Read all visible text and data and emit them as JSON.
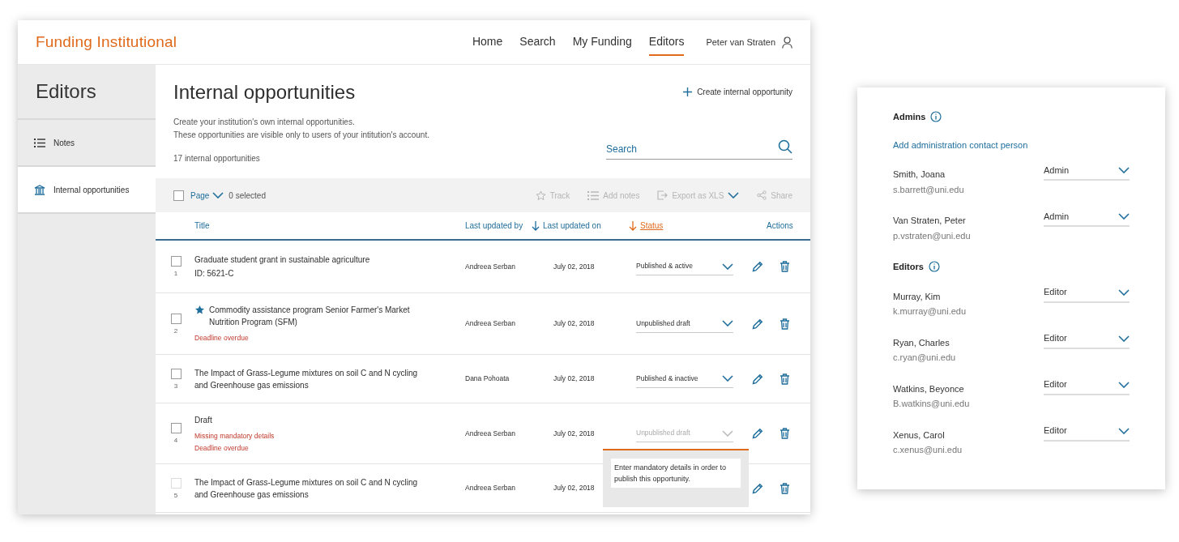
{
  "header": {
    "logo": "Funding Institutional",
    "nav": [
      {
        "label": "Home",
        "selected": false
      },
      {
        "label": "Search",
        "selected": false
      },
      {
        "label": "My Funding",
        "selected": false
      },
      {
        "label": "Editors",
        "selected": true
      }
    ],
    "user": "Peter van Straten"
  },
  "sidebar": {
    "title": "Editors",
    "items": [
      {
        "label": "Notes",
        "kind": "list",
        "selected": false
      },
      {
        "label": "Internal opportunities",
        "kind": "institution",
        "selected": true
      }
    ]
  },
  "main": {
    "title": "Internal opportunities",
    "create_button": "Create internal opportunity",
    "description": [
      "Create your institution's own internal opportunities.",
      "These opportunities are visible only to users of your intitution's account."
    ],
    "count": "17 internal opportunities",
    "search": {
      "placeholder": "Search"
    },
    "toolbar": {
      "select_all_checked": false,
      "page_label": "Page",
      "selected_count": "0 selected",
      "actions": [
        {
          "label": "Track",
          "kind": "star",
          "disabled": true
        },
        {
          "label": "Add notes",
          "kind": "list",
          "disabled": true
        },
        {
          "label": "Export as XLS",
          "kind": "export",
          "disabled": true
        },
        {
          "label": "Share",
          "kind": "share",
          "disabled": true
        }
      ]
    },
    "table": {
      "columns": [
        {
          "label": "Title",
          "sorted": false,
          "active": false
        },
        {
          "label": "Last updated by",
          "sorted": false,
          "active": false
        },
        {
          "label": "Last updated on",
          "sorted": true,
          "active": false
        },
        {
          "label": "Status",
          "sorted": true,
          "active": true
        },
        {
          "label": "Actions",
          "sorted": false,
          "active": false
        }
      ],
      "rows": [
        {
          "number": "1",
          "checked": false,
          "disabled": false,
          "starred": false,
          "title": "Graduate student grant in sustainable agriculture",
          "id": "ID: 5621-C",
          "warnings": [],
          "updated_by": "Andreea Serban",
          "updated_on": "July 02, 2018",
          "status": {
            "value": "Published & active",
            "disabled": false
          }
        },
        {
          "number": "2",
          "checked": false,
          "disabled": false,
          "starred": true,
          "title": "Commodity assistance program Senior Farmer's Market Nutrition Program (SFM)",
          "warnings": [
            "Deadline overdue"
          ],
          "updated_by": "Andreea Serban",
          "updated_on": "July 02, 2018",
          "status": {
            "value": "Unpublished draft",
            "disabled": false
          }
        },
        {
          "number": "3",
          "checked": false,
          "disabled": false,
          "starred": false,
          "title": "The Impact of Grass-Legume mixtures on soil C and N cycling and Greenhouse gas emissions",
          "warnings": [],
          "updated_by": "Dana Pohoata",
          "updated_on": "July 02, 2018",
          "status": {
            "value": "Published & inactive",
            "disabled": false
          }
        },
        {
          "number": "4",
          "checked": false,
          "disabled": false,
          "starred": false,
          "title": "Draft",
          "warnings": [
            "Missing mandatory details",
            "Deadline overdue"
          ],
          "updated_by": "Andreea Serban",
          "updated_on": "July 02, 2018",
          "status": {
            "value": "Unpublished draft",
            "disabled": true
          },
          "tooltip": "Enter mandatory details in order to publish this opportunity."
        },
        {
          "number": "5",
          "checked": false,
          "disabled": true,
          "starred": false,
          "title": "The Impact of Grass-Legume mixtures on soil C and N cycling and Greenhouse gas emissions",
          "warnings": [],
          "updated_by": "Andreea Serban",
          "updated_on": "July 02, 2018"
        }
      ]
    }
  },
  "roles_card": {
    "sections": [
      {
        "title": "Admins",
        "link": "Add administration contact person",
        "people": [
          {
            "name": "Smith, Joana",
            "email": "s.barrett@uni.edu",
            "role": "Admin"
          },
          {
            "name": "Van Straten, Peter",
            "email": "p.vstraten@uni.edu",
            "role": "Admin"
          }
        ]
      },
      {
        "title": "Editors",
        "people": [
          {
            "name": "Murray, Kim",
            "email": "k.murray@uni.edu",
            "role": "Editor"
          },
          {
            "name": "Ryan, Charles",
            "email": "c.ryan@uni.edu",
            "role": "Editor"
          },
          {
            "name": "Watkins, Beyonce",
            "email": "B.watkins@uni.edu",
            "role": "Editor"
          },
          {
            "name": "Xenus, Carol",
            "email": "c.xenus@uni.edu",
            "role": "Editor"
          }
        ]
      }
    ]
  }
}
